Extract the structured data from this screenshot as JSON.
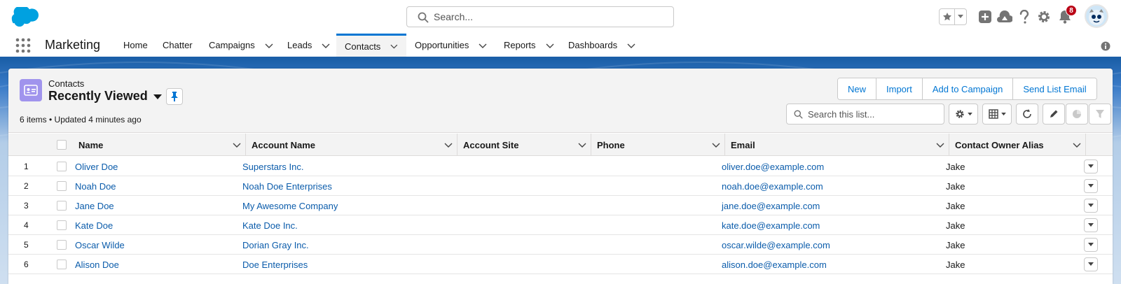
{
  "header": {
    "search_placeholder": "Search...",
    "notification_count": "8"
  },
  "nav": {
    "app_name": "Marketing",
    "items": [
      {
        "label": "Home"
      },
      {
        "label": "Chatter"
      },
      {
        "label": "Campaigns"
      },
      {
        "label": "Leads"
      },
      {
        "label": "Contacts"
      },
      {
        "label": "Opportunities"
      },
      {
        "label": "Reports"
      },
      {
        "label": "Dashboards"
      }
    ]
  },
  "list": {
    "object_label": "Contacts",
    "view_name": "Recently Viewed",
    "meta": "6 items • Updated 4 minutes ago",
    "actions": {
      "new": "New",
      "import": "Import",
      "add_to_campaign": "Add to Campaign",
      "send_list_email": "Send List Email"
    },
    "search_placeholder": "Search this list..."
  },
  "table": {
    "columns": {
      "name": "Name",
      "account_name": "Account Name",
      "account_site": "Account Site",
      "phone": "Phone",
      "email": "Email",
      "owner_alias": "Contact Owner Alias"
    },
    "rows": [
      {
        "num": "1",
        "name": "Oliver Doe",
        "account": "Superstars Inc.",
        "site": "",
        "phone": "",
        "email": "oliver.doe@example.com",
        "owner": "Jake"
      },
      {
        "num": "2",
        "name": "Noah Doe",
        "account": "Noah Doe Enterprises",
        "site": "",
        "phone": "",
        "email": "noah.doe@example.com",
        "owner": "Jake"
      },
      {
        "num": "3",
        "name": "Jane Doe",
        "account": "My Awesome Company",
        "site": "",
        "phone": "",
        "email": "jane.doe@example.com",
        "owner": "Jake"
      },
      {
        "num": "4",
        "name": "Kate Doe",
        "account": "Kate Doe Inc.",
        "site": "",
        "phone": "",
        "email": "kate.doe@example.com",
        "owner": "Jake"
      },
      {
        "num": "5",
        "name": "Oscar Wilde",
        "account": "Dorian Gray Inc.",
        "site": "",
        "phone": "",
        "email": "oscar.wilde@example.com",
        "owner": "Jake"
      },
      {
        "num": "6",
        "name": "Alison Doe",
        "account": "Doe Enterprises",
        "site": "",
        "phone": "",
        "email": "alison.doe@example.com",
        "owner": "Jake"
      }
    ]
  },
  "colors": {
    "brand_blue": "#0176d3",
    "link_blue": "#0b5cab",
    "contact_icon": "#a094ed",
    "badge_red": "#ba0517"
  }
}
